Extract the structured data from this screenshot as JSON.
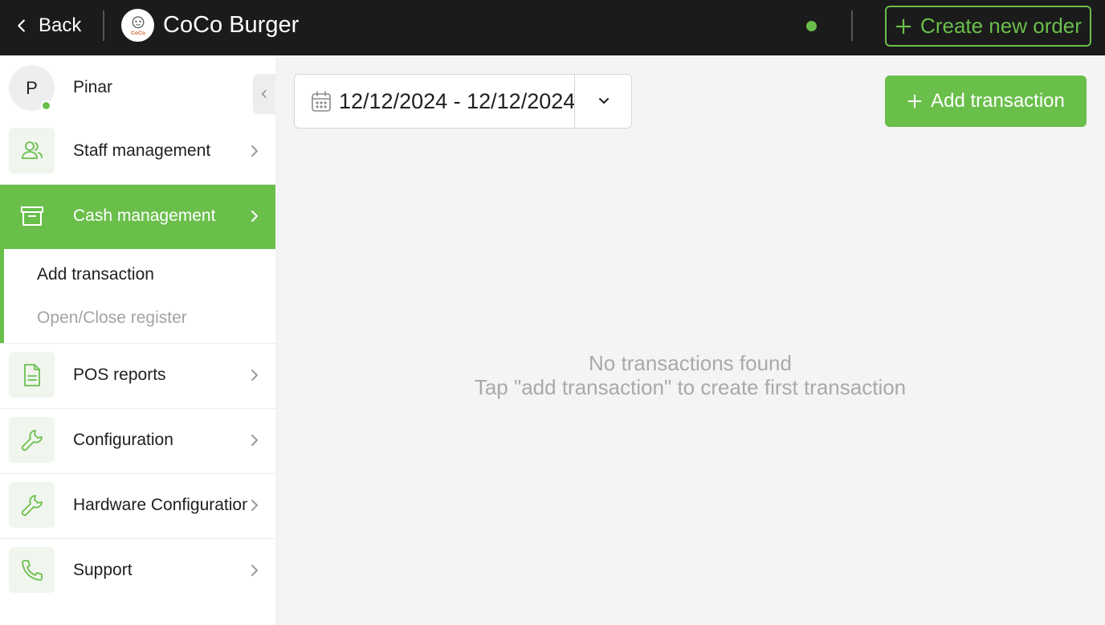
{
  "topbar": {
    "back_label": "Back",
    "app_title": "CoCo Burger",
    "logo_text": "CoCo",
    "create_order_label": "Create new order"
  },
  "user": {
    "initial": "P",
    "name": "Pinar",
    "status": "online"
  },
  "sidebar": {
    "items": [
      {
        "label": "Staff management",
        "icon": "staff-icon"
      },
      {
        "label": "Cash management",
        "icon": "archive-box-icon",
        "active": true
      },
      {
        "label": "POS reports",
        "icon": "document-icon"
      },
      {
        "label": "Configuration",
        "icon": "wrench-icon"
      },
      {
        "label": "Hardware Configuration",
        "icon": "wrench-icon"
      },
      {
        "label": "Support",
        "icon": "phone-icon"
      }
    ],
    "submenu": [
      {
        "label": "Add transaction",
        "current": true
      },
      {
        "label": "Open/Close register",
        "current": false
      }
    ]
  },
  "main": {
    "date_range": "12/12/2024 - 12/12/2024",
    "add_transaction_label": "Add transaction",
    "empty_title": "No transactions found",
    "empty_subtitle": "Tap \"add transaction\" to create first transaction"
  },
  "colors": {
    "accent": "#6abf4b",
    "topbar_bg": "#1b1b1b",
    "content_bg": "#f4f4f4"
  }
}
